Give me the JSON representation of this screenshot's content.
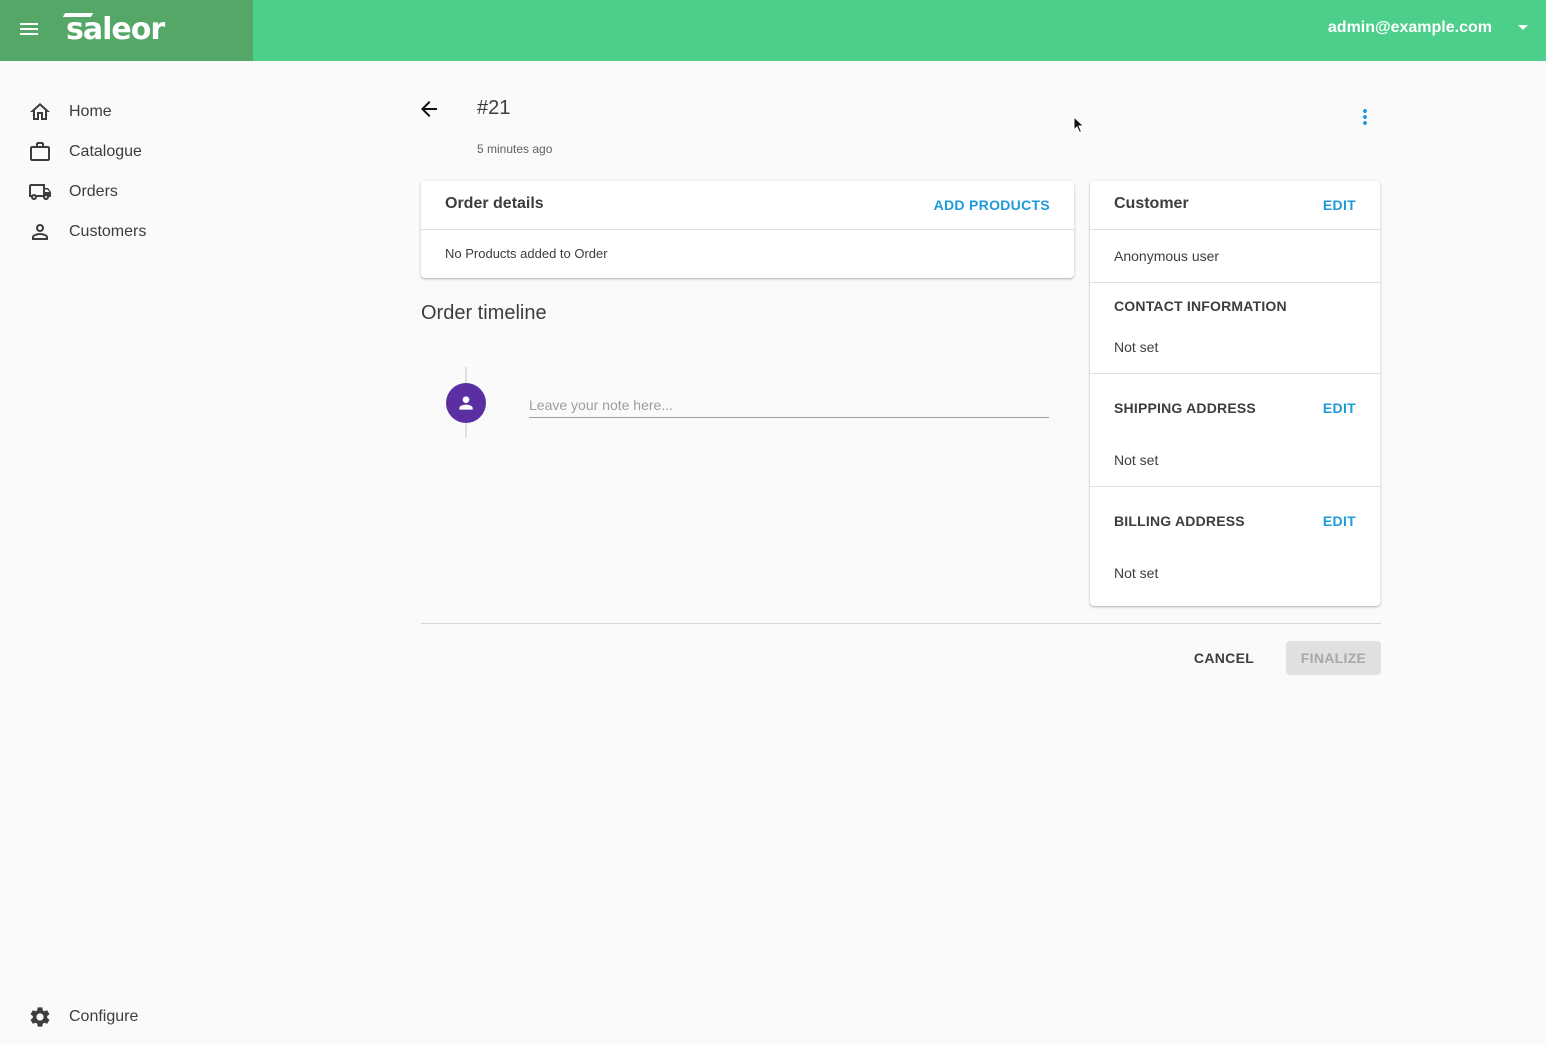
{
  "header": {
    "brand": "saleor",
    "user_email": "admin@example.com"
  },
  "sidebar": {
    "items": [
      {
        "label": "Home",
        "icon": "home-icon"
      },
      {
        "label": "Catalogue",
        "icon": "briefcase-icon"
      },
      {
        "label": "Orders",
        "icon": "truck-icon"
      },
      {
        "label": "Customers",
        "icon": "person-icon"
      }
    ],
    "footer_item": {
      "label": "Configure",
      "icon": "gear-icon"
    }
  },
  "page": {
    "title": "#21",
    "subtitle": "5 minutes ago"
  },
  "order_details": {
    "title": "Order details",
    "action": "ADD PRODUCTS",
    "empty_text": "No Products added to Order"
  },
  "timeline": {
    "heading": "Order timeline",
    "note_placeholder": "Leave your note here..."
  },
  "customer": {
    "title": "Customer",
    "edit": "EDIT",
    "name": "Anonymous user",
    "contact_title": "CONTACT INFORMATION",
    "contact_value": "Not set",
    "shipping_title": "SHIPPING ADDRESS",
    "shipping_edit": "EDIT",
    "shipping_value": "Not set",
    "billing_title": "BILLING ADDRESS",
    "billing_edit": "EDIT",
    "billing_value": "Not set"
  },
  "footer": {
    "cancel": "CANCEL",
    "finalize": "FINALIZE"
  },
  "colors": {
    "topbar": "#4ccf8b",
    "brand_bg": "#55a768",
    "accent": "#1d9bd8",
    "avatar": "#5b2ea1"
  }
}
